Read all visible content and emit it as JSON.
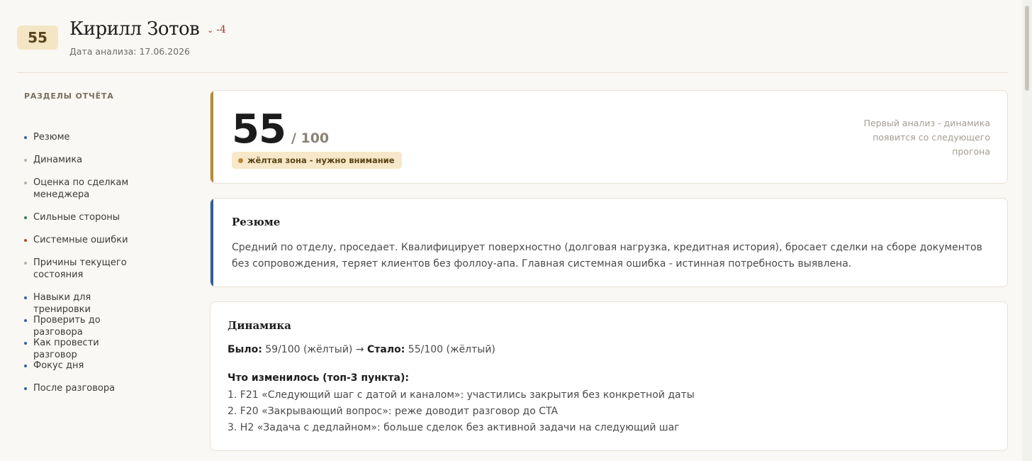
{
  "header": {
    "score": "55",
    "name": "Кирилл Зотов",
    "delta": "-4",
    "analysis_date": "Дата анализа: 17.06.2026"
  },
  "sidebar": {
    "title": "РАЗДЕЛЫ ОТЧЁТА",
    "items": [
      {
        "label": "Резюме",
        "dot_color": "#3a5f9a"
      },
      {
        "label": "Динамика",
        "dot_color": "#b7b1a6"
      },
      {
        "label": "Оценка по сделкам менеджера",
        "dot_color": "#b7b1a6"
      },
      {
        "label": "Сильные стороны",
        "dot_color": "#3a7a55"
      },
      {
        "label": "Системные ошибки",
        "dot_color": "#b04a30"
      },
      {
        "label": "Причины текущего состояния",
        "dot_color": "#b7b1a6"
      },
      {
        "label": "Навыки для тренировки",
        "dot_color": "#3a5f9a"
      },
      {
        "label": "Проверить до разговора",
        "dot_color": "#3a5f9a"
      },
      {
        "label": "Как провести разговор",
        "dot_color": "#3a5f9a"
      },
      {
        "label": "Фокус дня",
        "dot_color": "#3a5f9a"
      },
      {
        "label": "После разговора",
        "dot_color": "#3a5f9a"
      }
    ]
  },
  "score_card": {
    "score": "55",
    "out_of": "/ 100",
    "zone_label": "жёлтая зона - нужно внимание",
    "first_analysis_note": "Первый анализ - динамика появится со следующего прогона",
    "accent_color": "#b78a3a"
  },
  "resume": {
    "title": "Резюме",
    "text": "Средний по отделу, проседает. Квалифицирует поверхностно (долговая нагрузка, кредитная история), бросает сделки на сборе документов без сопровождения, теряет клиентов без фоллоу-апа. Главная системная ошибка - истинная потребность выявлена.",
    "accent_color": "#2f5f9a"
  },
  "dynamics": {
    "title": "Динамика",
    "was_label": "Было:",
    "was_value": "59/100 (жёлтый)",
    "arrow": "→",
    "now_label": "Стало:",
    "now_value": "55/100 (жёлтый)",
    "changes_title": "Что изменилось (топ-3 пункта):",
    "changes": [
      "1. F21 «Следующий шаг с датой и каналом»: участились закрытия без конкретной даты",
      "2. F20 «Закрывающий вопрос»: реже доводит разговор до CTA",
      "3. H2 «Задача с дедлайном»: больше сделок без активной задачи на следующий шаг"
    ]
  }
}
